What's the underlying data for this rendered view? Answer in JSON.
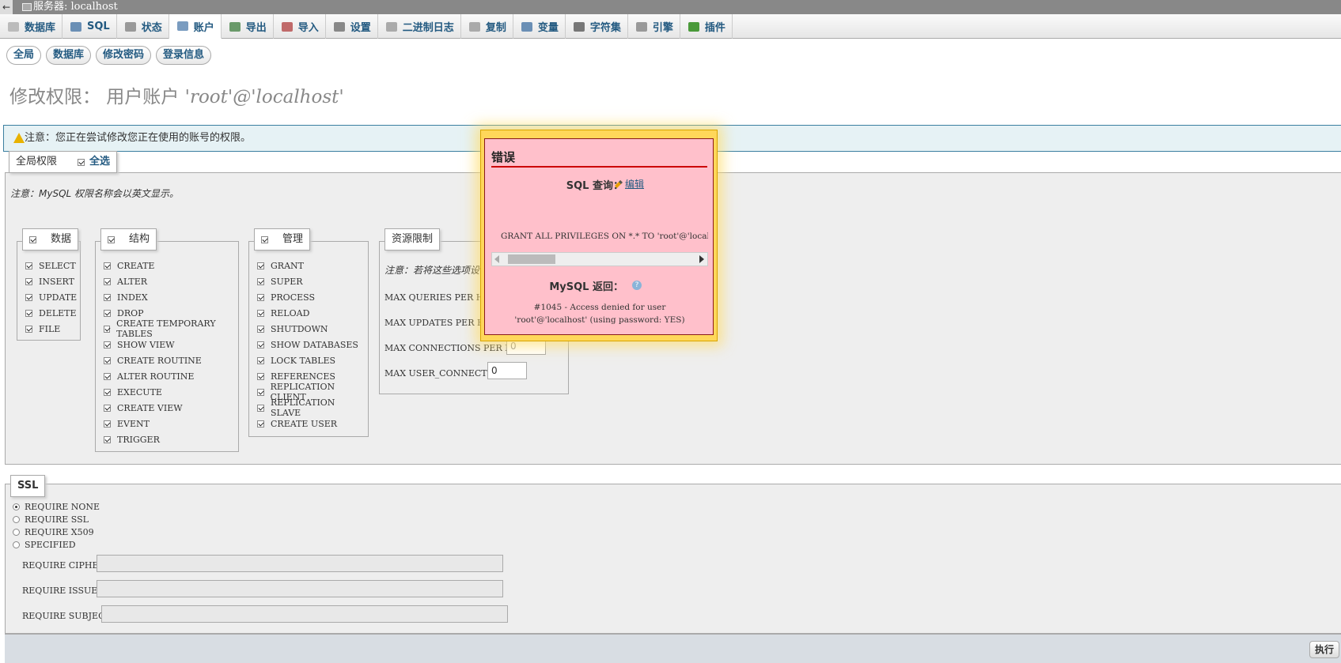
{
  "window": {
    "title": "服务器: localhost"
  },
  "tabs": [
    {
      "label": "数据库",
      "icon": "database-icon",
      "color": "#bbbbbb"
    },
    {
      "label": "SQL",
      "icon": "sql-icon",
      "color": "#6a8fb5"
    },
    {
      "label": "状态",
      "icon": "status-icon",
      "color": "#999999"
    },
    {
      "label": "账户",
      "icon": "users-icon",
      "color": "#7a9cc0"
    },
    {
      "label": "导出",
      "icon": "export-icon",
      "color": "#6a9a6a"
    },
    {
      "label": "导入",
      "icon": "import-icon",
      "color": "#c06a6a"
    },
    {
      "label": "设置",
      "icon": "wrench-icon",
      "color": "#888888"
    },
    {
      "label": "二进制日志",
      "icon": "binlog-icon",
      "color": "#aaaaaa"
    },
    {
      "label": "复制",
      "icon": "replication-icon",
      "color": "#aaaaaa"
    },
    {
      "label": "变量",
      "icon": "variables-icon",
      "color": "#6a8fb5"
    },
    {
      "label": "字符集",
      "icon": "charset-icon",
      "color": "#777777"
    },
    {
      "label": "引擎",
      "icon": "engine-icon",
      "color": "#999999"
    },
    {
      "label": "插件",
      "icon": "plugin-icon",
      "color": "#4a9a3a"
    }
  ],
  "subtabs": [
    "全局",
    "数据库",
    "修改密码",
    "登录信息"
  ],
  "page": {
    "title_prefix": "修改权限： 用户账户",
    "user": "'root'@'localhost'",
    "notice": "注意：您正在尝试修改您正在使用的账号的权限。"
  },
  "global": {
    "legend": "全局权限",
    "select_all": "全选",
    "note": "注意：MySQL 权限名称会以英文显示。",
    "data": {
      "legend": "数据",
      "items": [
        "SELECT",
        "INSERT",
        "UPDATE",
        "DELETE",
        "FILE"
      ]
    },
    "structure": {
      "legend": "结构",
      "items": [
        "CREATE",
        "ALTER",
        "INDEX",
        "DROP",
        "CREATE TEMPORARY TABLES",
        "SHOW VIEW",
        "CREATE ROUTINE",
        "ALTER ROUTINE",
        "EXECUTE",
        "CREATE VIEW",
        "EVENT",
        "TRIGGER"
      ]
    },
    "admin": {
      "legend": "管理",
      "items": [
        "GRANT",
        "SUPER",
        "PROCESS",
        "RELOAD",
        "SHUTDOWN",
        "SHOW DATABASES",
        "LOCK TABLES",
        "REFERENCES",
        "REPLICATION CLIENT",
        "REPLICATION SLAVE",
        "CREATE USER"
      ]
    },
    "resources": {
      "legend": "资源限制",
      "note": "注意：若将这些选项设",
      "rows": [
        {
          "label": "MAX QUERIES PER HOUR",
          "value": ""
        },
        {
          "label": "MAX UPDATES PER HOUR",
          "value": ""
        },
        {
          "label": "MAX CONNECTIONS PER HOUR",
          "value": "0"
        },
        {
          "label": "MAX USER_CONNECTIONS",
          "value": "0"
        }
      ]
    }
  },
  "ssl": {
    "legend": "SSL",
    "options": [
      {
        "label": "REQUIRE NONE",
        "selected": true
      },
      {
        "label": "REQUIRE SSL",
        "selected": false
      },
      {
        "label": "REQUIRE X509",
        "selected": false
      },
      {
        "label": "SPECIFIED",
        "selected": false
      }
    ],
    "fields": [
      "REQUIRE CIPHER",
      "REQUIRE ISSUER",
      "REQUIRE SUBJECT"
    ]
  },
  "footer": {
    "go": "执行"
  },
  "error": {
    "title": "错误",
    "sql_query_label": "SQL 查询：",
    "edit": "编辑",
    "sql": "GRANT ALL PRIVILEGES ON  *.* TO 'root'@'localhost' REQUIRE NONE WITH GRANT OPTION",
    "mysql_returned": "MySQL 返回：",
    "message_line1": "#1045 - Access denied for user",
    "message_line2": "'root'@'localhost' (using password: YES)"
  }
}
